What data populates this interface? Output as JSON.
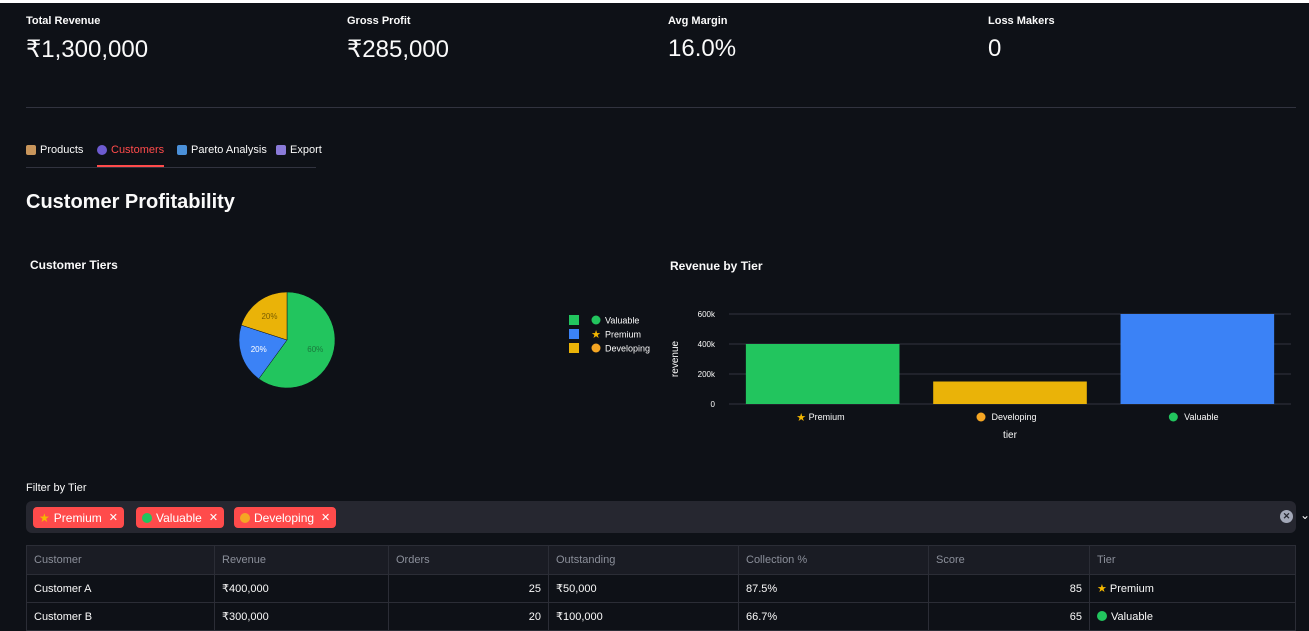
{
  "metrics": [
    {
      "label": "Total Revenue",
      "value": "₹1,300,000"
    },
    {
      "label": "Gross Profit",
      "value": "₹285,000"
    },
    {
      "label": "Avg Margin",
      "value": "16.0%"
    },
    {
      "label": "Loss Makers",
      "value": "0"
    }
  ],
  "tabs": [
    {
      "label": "Products",
      "icon": "package-icon",
      "active": false
    },
    {
      "label": "Customers",
      "icon": "users-icon",
      "active": true
    },
    {
      "label": "Pareto Analysis",
      "icon": "bar-chart-icon",
      "active": false
    },
    {
      "label": "Export",
      "icon": "inbox-tray-icon",
      "active": false
    }
  ],
  "page_title": "Customer Profitability",
  "colors": {
    "accent": "#ff4b4b",
    "valuable": "#22c55e",
    "premium": "#3b82f6",
    "developing": "#eab308"
  },
  "chart_data": [
    {
      "type": "pie",
      "title": "Customer Tiers",
      "labels": [
        "Valuable",
        "Premium",
        "Developing"
      ],
      "label_icons": [
        "green-circle-icon",
        "star-icon",
        "orange-circle-icon"
      ],
      "values": [
        60,
        20,
        20
      ],
      "value_labels": [
        "60%",
        "20%",
        "20%"
      ],
      "colors": [
        "#22c55e",
        "#3b82f6",
        "#eab308"
      ],
      "legend": "right"
    },
    {
      "type": "bar",
      "title": "Revenue by Tier",
      "categories": [
        "Premium",
        "Developing",
        "Valuable"
      ],
      "category_icons": [
        "star-icon",
        "orange-circle-icon",
        "green-circle-icon"
      ],
      "values": [
        400000,
        150000,
        600000
      ],
      "colors": [
        "#22c55e",
        "#eab308",
        "#3b82f6"
      ],
      "xlabel": "tier",
      "ylabel": "revenue",
      "yticks": [
        "0",
        "200k",
        "400k",
        "600k"
      ],
      "ylim": [
        0,
        600000
      ],
      "grid": true
    }
  ],
  "filter": {
    "label": "Filter by Tier",
    "chips": [
      {
        "label": "Premium",
        "icon": "star-icon"
      },
      {
        "label": "Valuable",
        "icon": "green-circle-icon"
      },
      {
        "label": "Developing",
        "icon": "orange-circle-icon"
      }
    ]
  },
  "table": {
    "columns": [
      "Customer",
      "Revenue",
      "Orders",
      "Outstanding",
      "Collection %",
      "Score",
      "Tier"
    ],
    "rows": [
      [
        "Customer A",
        "₹400,000",
        "25",
        "₹50,000",
        "87.5%",
        "85",
        "Premium"
      ],
      [
        "Customer B",
        "₹300,000",
        "20",
        "₹100,000",
        "66.7%",
        "65",
        "Valuable"
      ]
    ]
  }
}
